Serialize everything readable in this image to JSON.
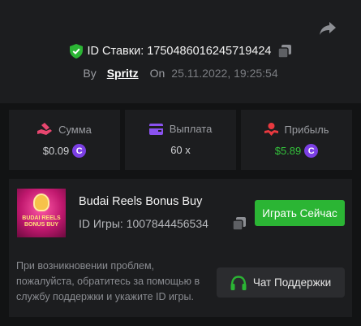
{
  "bet": {
    "id_label": "ID Ставки:",
    "id_value": "1750486016245719424",
    "by_label": "By",
    "user": "Spritz",
    "on_label": "On",
    "date": "25.11.2022, 19:25:54"
  },
  "stats": {
    "amount": {
      "label": "Сумма",
      "value": "$0.09"
    },
    "payout": {
      "label": "Выплата",
      "value": "60 x"
    },
    "profit": {
      "label": "Прибыль",
      "value": "$5.89"
    }
  },
  "game": {
    "name": "Budai Reels Bonus Buy",
    "id_label": "ID Игры:",
    "id_value": "1007844456534",
    "thumb_text": "BUDAI REELS BONUS BUY",
    "play_label": "Играть Сейчас"
  },
  "help": {
    "text": "При возникновении проблем, пожалуйста, обратитесь за помощью в службу поддержки и укажите ID игры.",
    "support_label": "Чат Поддержки"
  },
  "coin_symbol": "C",
  "colors": {
    "accent_green": "#2bb534",
    "profit_green": "#33c13b",
    "coin_purple": "#7b3fe4",
    "amount_icon": "#e8466f",
    "payout_icon": "#8a52f0",
    "profit_icon": "#e8393f"
  },
  "icons": {
    "share": "share-arrow-icon",
    "verified": "shield-check-icon",
    "copy": "copy-icon",
    "amount": "hand-coin-icon",
    "payout": "wallet-icon",
    "profit": "person-hands-icon",
    "support": "headphones-icon"
  }
}
